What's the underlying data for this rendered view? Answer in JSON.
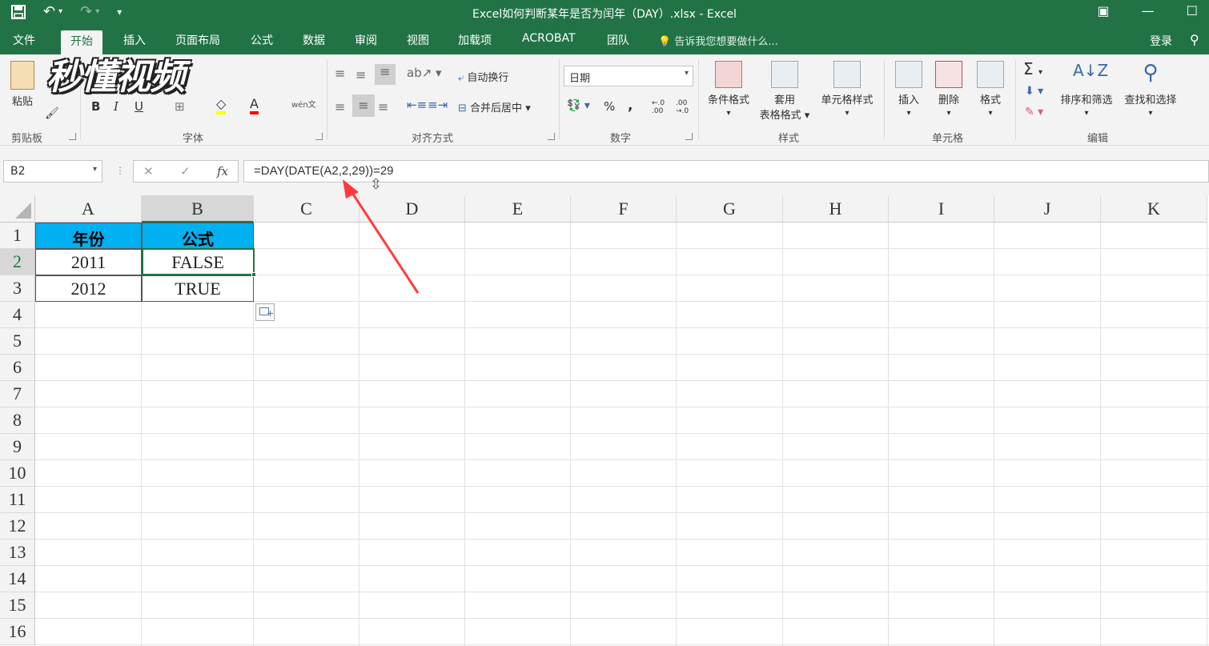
{
  "titlebar": {
    "title": "Excel如何判断某年是否为闰年（DAY）.xlsx - Excel",
    "save_icon": "save-icon",
    "undo_icon": "undo-icon",
    "redo_icon": "redo-icon"
  },
  "tabs": [
    "文件",
    "开始",
    "插入",
    "页面布局",
    "公式",
    "数据",
    "审阅",
    "视图",
    "加载项",
    "ACROBAT",
    "团队"
  ],
  "active_tab": "开始",
  "tell_me": "告诉我您想要做什么...",
  "login": "登录",
  "watermark": "秒懂视频",
  "ribbon": {
    "clipboard": {
      "paste": "粘贴",
      "label": "剪贴板"
    },
    "font": {
      "bold": "B",
      "italic": "I",
      "underline": "U",
      "font_color": "A",
      "wen": "wén文",
      "label": "字体"
    },
    "alignment": {
      "wrap": "自动换行",
      "merge": "合并后居中",
      "label": "对齐方式"
    },
    "number": {
      "format": "日期",
      "percent": "%",
      "comma": ",",
      "inc_decimal": "←.0 .00",
      "dec_decimal": ".00 →.0",
      "label": "数字"
    },
    "styles": {
      "conditional": "条件格式",
      "table_fmt_1": "套用",
      "table_fmt_2": "表格格式",
      "cell_style": "单元格样式",
      "label": "样式"
    },
    "cells": {
      "insert": "插入",
      "delete": "删除",
      "format": "格式",
      "label": "单元格"
    },
    "editing": {
      "sum": "Σ",
      "sort": "排序和筛选",
      "find": "查找和选择",
      "label": "编辑"
    }
  },
  "formula_bar": {
    "name_box": "B2",
    "cancel": "✕",
    "enter": "✓",
    "fx": "fx",
    "formula": "=DAY(DATE(A2,2,29))=29"
  },
  "columns": [
    "A",
    "B",
    "C",
    "D",
    "E",
    "F",
    "G",
    "H",
    "I",
    "J",
    "K"
  ],
  "rows": [
    "1",
    "2",
    "3",
    "4",
    "5",
    "6",
    "7",
    "8",
    "9",
    "10",
    "11",
    "12",
    "13",
    "14",
    "15",
    "16"
  ],
  "cells": {
    "A1": "年份",
    "B1": "公式",
    "A2": "2011",
    "B2": "FALSE",
    "A3": "2012",
    "B3": "TRUE"
  },
  "colors": {
    "excel_green": "#217346",
    "header_fill": "#00b0f0",
    "arrow_red": "#ff3b3b"
  }
}
